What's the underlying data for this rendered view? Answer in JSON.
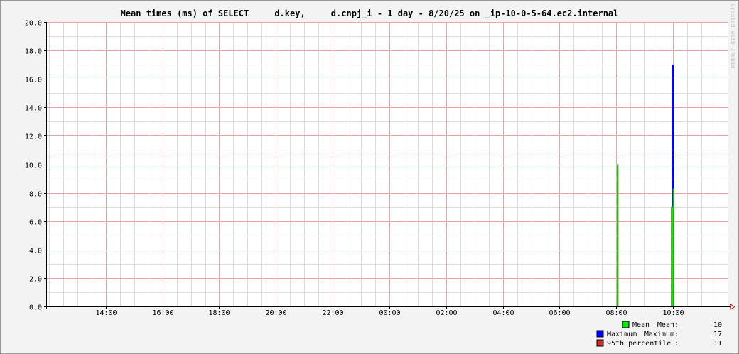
{
  "chart_data": {
    "type": "bar",
    "title": "Mean times (ms) of SELECT     d.key,     d.cnpj_i - 1 day - 8/20/25 on _ip-10-0-5-64.ec2.internal",
    "watermark": "Created with JRobin",
    "xlabel": "",
    "ylabel": "",
    "x_ticks": [
      "14:00",
      "16:00",
      "18:00",
      "20:00",
      "22:00",
      "00:00",
      "02:00",
      "04:00",
      "06:00",
      "08:00",
      "10:00"
    ],
    "y_ticks": [
      "0.0",
      "2.0",
      "4.0",
      "6.0",
      "8.0",
      "10.0",
      "12.0",
      "14.0",
      "16.0",
      "18.0",
      "20.0"
    ],
    "ylim": [
      0,
      20
    ],
    "x_range_hours": [
      11.9,
      35.95
    ],
    "grid": true,
    "legend_position": "bottom-right",
    "percentile_line": 10.5,
    "series": [
      {
        "name": "Maximum",
        "color": "#0000ff",
        "points": [
          {
            "x_hours": 32.03,
            "value": 10
          },
          {
            "x_hours": 33.97,
            "value": 17
          }
        ]
      },
      {
        "name": "Mean",
        "color": "#00ee00",
        "points": [
          {
            "x_hours": 32.03,
            "value": 10
          },
          {
            "x_hours": 33.95,
            "value": 7
          },
          {
            "x_hours": 33.99,
            "value": 8.3
          }
        ]
      }
    ],
    "legend": [
      {
        "label": "Mean",
        "stat_label": "Mean:",
        "stat_value": "10",
        "color": "#00ee00"
      },
      {
        "label": "Maximum",
        "stat_label": "Maximum:",
        "stat_value": "17",
        "color": "#0000ff"
      },
      {
        "label": "95th percentile",
        "stat_label": ":",
        "stat_value": "11",
        "color": "#cc3333"
      }
    ]
  }
}
